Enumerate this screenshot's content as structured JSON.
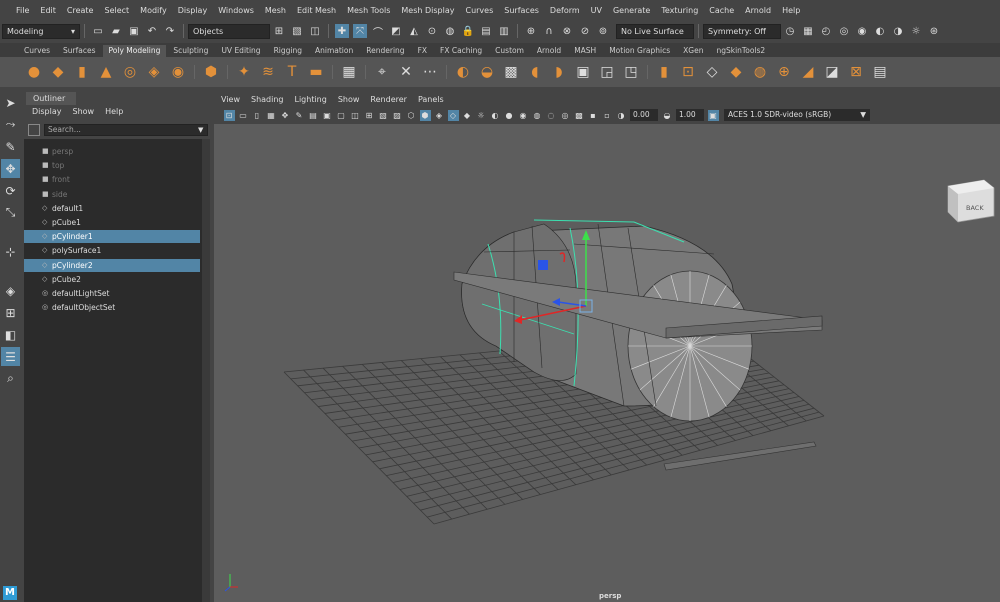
{
  "menubar": [
    "File",
    "Edit",
    "Create",
    "Select",
    "Modify",
    "Display",
    "Windows",
    "Mesh",
    "Edit Mesh",
    "Mesh Tools",
    "Mesh Display",
    "Curves",
    "Surfaces",
    "Deform",
    "UV",
    "Generate",
    "Texturing",
    "Cache",
    "Arnold",
    "Help"
  ],
  "statusline": {
    "menuset": "Modeling",
    "select_mode": "Objects",
    "live_surface": "No Live Surface",
    "symmetry": "Symmetry: Off"
  },
  "shelf_tabs": [
    "Curves",
    "Surfaces",
    "Poly Modeling",
    "Sculpting",
    "UV Editing",
    "Rigging",
    "Animation",
    "Rendering",
    "FX",
    "FX Caching",
    "Custom",
    "Arnold",
    "MASH",
    "Motion Graphics",
    "XGen",
    "ngSkinTools2"
  ],
  "shelf_active_tab": "Poly Modeling",
  "outliner": {
    "tab": "Outliner",
    "menu": [
      "Display",
      "Show",
      "Help"
    ],
    "search_placeholder": "Search...",
    "items": [
      {
        "label": "persp",
        "type": "camera",
        "dim": true,
        "selected": false
      },
      {
        "label": "top",
        "type": "camera",
        "dim": true,
        "selected": false
      },
      {
        "label": "front",
        "type": "camera",
        "dim": true,
        "selected": false
      },
      {
        "label": "side",
        "type": "camera",
        "dim": true,
        "selected": false
      },
      {
        "label": "default1",
        "type": "mesh",
        "dim": false,
        "selected": false
      },
      {
        "label": "pCube1",
        "type": "mesh",
        "dim": false,
        "selected": false
      },
      {
        "label": "pCylinder1",
        "type": "mesh",
        "dim": false,
        "selected": true
      },
      {
        "label": "polySurface1",
        "type": "mesh",
        "dim": false,
        "selected": false
      },
      {
        "label": "pCylinder2",
        "type": "mesh",
        "dim": false,
        "selected": true
      },
      {
        "label": "pCube2",
        "type": "mesh",
        "dim": false,
        "selected": false
      },
      {
        "label": "defaultLightSet",
        "type": "set",
        "dim": false,
        "selected": false
      },
      {
        "label": "defaultObjectSet",
        "type": "set",
        "dim": false,
        "selected": false
      }
    ]
  },
  "viewport": {
    "menu": [
      "View",
      "Shading",
      "Lighting",
      "Show",
      "Renderer",
      "Panels"
    ],
    "exposure": "0.00",
    "gamma": "1.00",
    "color_space": "ACES 1.0 SDR-video (sRGB)",
    "camera_label": "persp",
    "viewcube_face": "BACK"
  },
  "logo": "M",
  "colors": {
    "selection": "#5285a6",
    "background": "#444444",
    "viewport_bg": "#5d5d5d",
    "shelf_icon": "#e3913a",
    "wire_selected": "#3ce0b0"
  }
}
